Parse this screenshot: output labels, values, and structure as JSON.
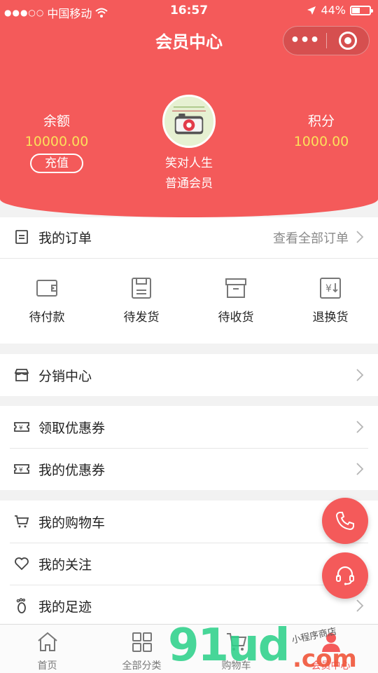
{
  "status_bar": {
    "carrier": "中国移动",
    "time": "16:57",
    "battery": "44%"
  },
  "nav": {
    "title": "会员中心"
  },
  "colors": {
    "brand_red": "#f45a5a",
    "value_yellow": "#fbe05a"
  },
  "profile": {
    "balance_label": "余额",
    "balance_value": "10000.00",
    "recharge_label": "充值",
    "points_label": "积分",
    "points_value": "1000.00",
    "username": "笑对人生",
    "level": "普通会员"
  },
  "orders": {
    "title": "我的订单",
    "view_all": "查看全部订单",
    "shortcuts": [
      {
        "label": "待付款",
        "icon": "wallet-icon"
      },
      {
        "label": "待发货",
        "icon": "package-icon"
      },
      {
        "label": "待收货",
        "icon": "box-icon"
      },
      {
        "label": "退换货",
        "icon": "refund-icon"
      }
    ]
  },
  "menu": {
    "distribution": "分销中心",
    "get_coupon": "领取优惠券",
    "my_coupon": "我的优惠券",
    "cart": "我的购物车",
    "follow": "我的关注",
    "footprint": "我的足迹"
  },
  "tabbar": [
    {
      "label": "首页",
      "icon": "home-icon"
    },
    {
      "label": "全部分类",
      "icon": "grid-icon"
    },
    {
      "label": "购物车",
      "icon": "cart-icon"
    },
    {
      "label": "会员中心",
      "icon": "user-icon"
    }
  ],
  "watermark": {
    "digits": "91ud",
    "com": ".com",
    "small": "小程序商店"
  }
}
